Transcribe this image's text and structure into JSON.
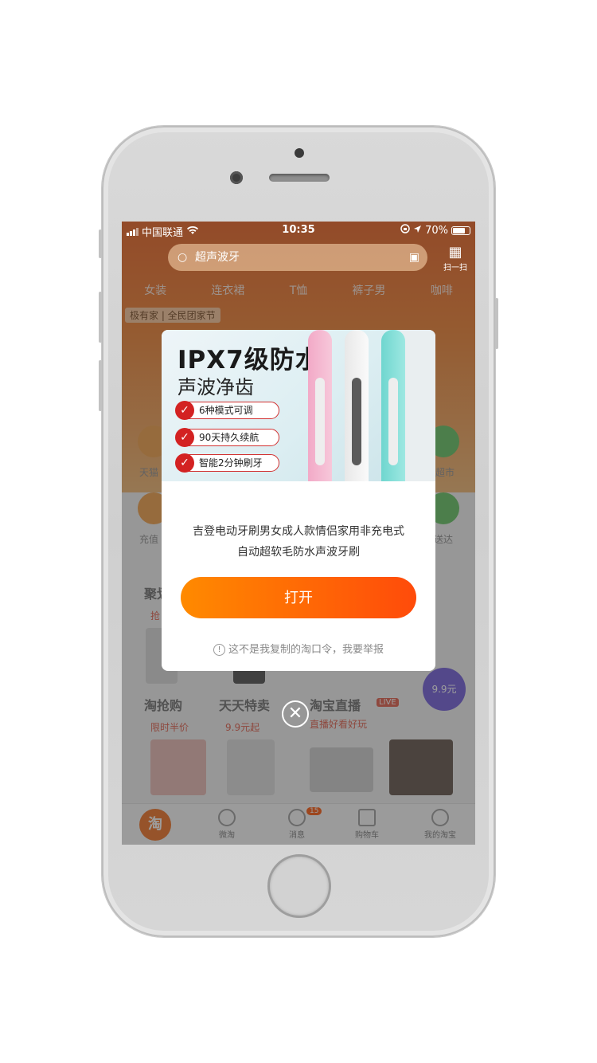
{
  "status_bar": {
    "carrier": "中国联通",
    "time": "10:35",
    "battery": "70%"
  },
  "background_app": {
    "search_placeholder": "超声波牙",
    "scan_label": "扫一扫",
    "tabs": [
      "女装",
      "连衣裙",
      "T恤",
      "裤子男",
      "咖啡"
    ],
    "tagline": "极有家 | 全民团家节",
    "grid_labels": [
      "天猫",
      "超市",
      "充值",
      "送达"
    ],
    "sections": [
      {
        "title": "聚划算",
        "subtitle": "抢"
      },
      {
        "title": "淘抢购",
        "subtitle": "限时半价"
      },
      {
        "title": "天天特卖",
        "subtitle": "9.9元起"
      },
      {
        "title": "淘宝直播",
        "subtitle": "直播好看好玩",
        "badge": "LIVE"
      }
    ],
    "promo_badge": "9.9元",
    "bottom_nav": [
      {
        "label": "淘",
        "icon": "taobao-logo"
      },
      {
        "label": "微淘",
        "icon": "weitao-icon"
      },
      {
        "label": "消息",
        "icon": "message-icon",
        "badge": "15"
      },
      {
        "label": "购物车",
        "icon": "cart-icon"
      },
      {
        "label": "我的淘宝",
        "icon": "profile-icon"
      }
    ]
  },
  "modal": {
    "banner": {
      "title": "IPX7级防水",
      "subtitle": "声波净齿",
      "features": [
        "6种模式可调",
        "90天持久续航",
        "智能2分钟刷牙"
      ]
    },
    "product_line1": "吉登电动牙刷男女成人款情侣家用非充电式",
    "product_line2": "自动超软毛防水声波牙刷",
    "open_button": "打开",
    "report_text": "这不是我复制的淘口令，我要举报"
  },
  "colors": {
    "accent": "#ff6a00",
    "accent_end": "#ff4b0a",
    "check_red": "#d32222"
  }
}
